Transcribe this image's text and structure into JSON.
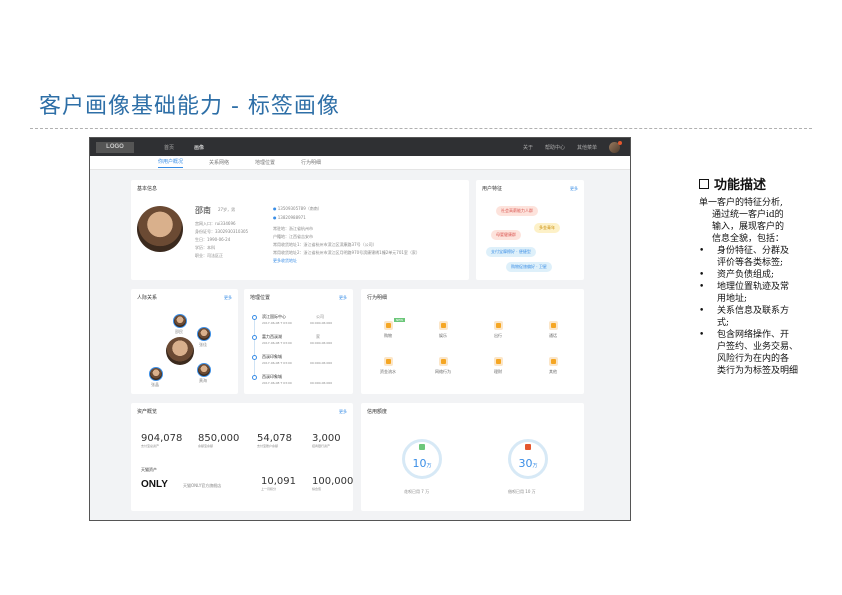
{
  "slide": {
    "title": "客户画像基础能力 - 标签画像"
  },
  "app": {
    "logo": "LOGO",
    "nav": [
      "首页",
      "画像"
    ],
    "right_nav": [
      "关于",
      "帮助中心",
      "其他菜单"
    ],
    "tabs": [
      "你用户概况",
      "关系网络",
      "地理位置",
      "行为明细"
    ],
    "basic": {
      "title": "基本信息",
      "name": "邵南",
      "age_gender": "27岁，男",
      "fields": [
        "宫网入口：rui334696",
        "身份证号：3302930310305",
        "生日：1990-06-24",
        "学历：本科",
        "职业：司法区正"
      ],
      "contacts": [
        "13509305789（南南）",
        "13820988971"
      ],
      "right_fields": [
        "常驻地：浙江省杭州市",
        "户籍地：江西省吉安市",
        "常用收货地址1：浙江省杭州市滨江区滨康路37号（公司）",
        "常用收货地址2：浙江省杭州市滨江区月明路970号滨康锦绣1幢2单元701室（家）"
      ],
      "more_addr": "更多收货地址"
    },
    "traits": {
      "title": "用户特征",
      "more": "更多",
      "tags": [
        "社会高薪能力人群",
        "多金青年",
        "母婴健康群",
        "支付宝摩擦好 · 便捷型",
        "购物促旅偏好 · 卫星"
      ]
    },
    "relations": {
      "title": "人际关系",
      "more": "更多",
      "names": [
        "邵民",
        "张佳",
        "张晶",
        "黄海"
      ]
    },
    "geo": {
      "title": "地理位置",
      "more": "更多",
      "items": [
        {
          "place": "滨江国际中心",
          "tag": "公司",
          "time": "2017-06-08 T 03:00",
          "range": "09:000-06:000"
        },
        {
          "place": "富力西溪湖",
          "tag": "家",
          "time": "2017-06-08 T 03:00",
          "range": "09:000-06:000"
        },
        {
          "place": "西溪印象城",
          "tag": "",
          "time": "2017-06-08 T 03:00",
          "range": "09:000-06:000"
        },
        {
          "place": "西溪印象城",
          "tag": "",
          "time": "2017-06-08 T 03:00",
          "range": "09:000-06:000"
        }
      ]
    },
    "behavior": {
      "title": "行为明细",
      "badge": "NEW",
      "items": [
        "购物",
        "娱乐",
        "出行",
        "通话",
        "资金流水",
        "网络行为",
        "理财",
        "其他"
      ]
    },
    "assets": {
      "title": "资产概览",
      "more": "更多",
      "stats": [
        {
          "value": "904,078",
          "label": "支付宝总资产"
        },
        {
          "value": "850,000",
          "label": "余额宝余额"
        },
        {
          "value": "54,078",
          "label": "支付宝账户余额"
        },
        {
          "value": "3,000",
          "label": "招商银行资产"
        }
      ],
      "sub_title": "天猫资产",
      "brand": "ONLY",
      "brand_label": "天猫ONLY官方旗舰店",
      "stats2": [
        {
          "value": "10,091",
          "label": "上一月积分"
        },
        {
          "value": "100,000",
          "label": "综合值"
        }
      ]
    },
    "credit": {
      "title": "信用额度",
      "rings": [
        {
          "num": "10",
          "unit": "万",
          "label": "花呗已用 7 万"
        },
        {
          "num": "30",
          "unit": "万",
          "label": "借呗已用 10 万"
        }
      ]
    }
  },
  "description": {
    "heading": "功能描述",
    "intro": [
      "单一客户的特征分析,",
      "通过统一客户id的",
      "输入，展现客户的",
      "信息全貌，包括："
    ],
    "bullets": [
      [
        "身份特征、分群及",
        "评价等各类标签;"
      ],
      [
        "资产负债组成;"
      ],
      [
        "地理位置轨迹及常",
        "用地址;"
      ],
      [
        "关系信息及联系方",
        "式;"
      ],
      [
        "包含网络操作、开",
        "户签约、业务交易、",
        "风险行为在内的各",
        "类行为为标签及明细"
      ]
    ]
  }
}
